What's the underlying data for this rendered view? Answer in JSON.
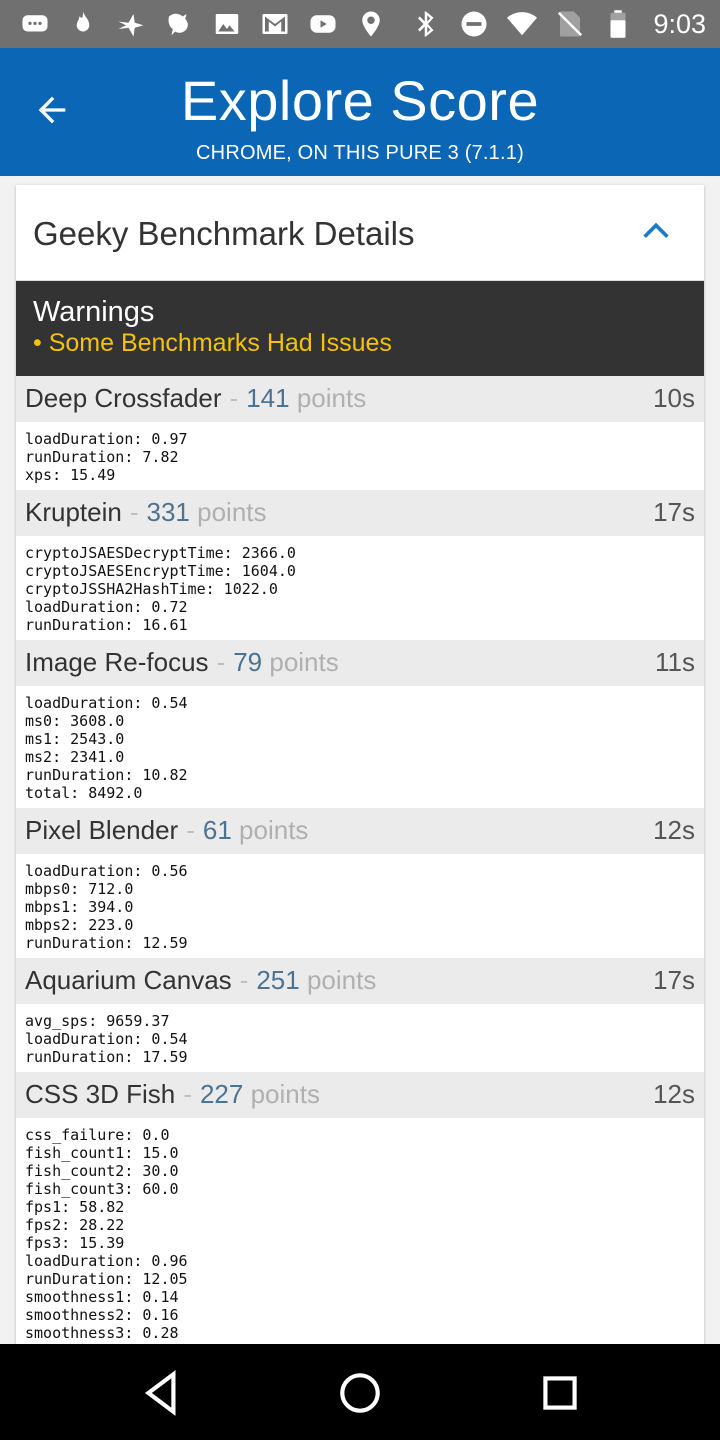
{
  "status_bar": {
    "time": "9:03",
    "left_icons": [
      "messages-icon",
      "fire-icon",
      "bird-icon",
      "dragon-icon",
      "image-icon",
      "gmail-icon",
      "youtube-icon",
      "location-icon"
    ],
    "right_icons": [
      "bluetooth-icon",
      "do-not-disturb-icon",
      "wifi-icon",
      "no-sim-icon",
      "battery-icon"
    ]
  },
  "app_bar": {
    "title": "Explore Score",
    "subtitle": "CHROME, ON THIS PURE 3 (7.1.1)"
  },
  "card": {
    "title": "Geeky Benchmark Details",
    "warnings_title": "Warnings",
    "warning_item": "• Some Benchmarks Had Issues"
  },
  "benchmarks": [
    {
      "name": "Deep Crossfader",
      "points": "141",
      "points_label": "points",
      "time": "10s",
      "metrics": [
        "loadDuration: 0.97",
        "runDuration: 7.82",
        "xps: 15.49"
      ]
    },
    {
      "name": "Kruptein",
      "points": "331",
      "points_label": "points",
      "time": "17s",
      "metrics": [
        "cryptoJSAESDecryptTime: 2366.0",
        "cryptoJSAESEncryptTime: 1604.0",
        "cryptoJSSHA2HashTime: 1022.0",
        "loadDuration: 0.72",
        "runDuration: 16.61"
      ]
    },
    {
      "name": "Image Re-focus",
      "points": "79",
      "points_label": "points",
      "time": "11s",
      "metrics": [
        "loadDuration: 0.54",
        "ms0: 3608.0",
        "ms1: 2543.0",
        "ms2: 2341.0",
        "runDuration: 10.82",
        "total: 8492.0"
      ]
    },
    {
      "name": "Pixel Blender",
      "points": "61",
      "points_label": "points",
      "time": "12s",
      "metrics": [
        "loadDuration: 0.56",
        "mbps0: 712.0",
        "mbps1: 394.0",
        "mbps2: 223.0",
        "runDuration: 12.59"
      ]
    },
    {
      "name": "Aquarium Canvas",
      "points": "251",
      "points_label": "points",
      "time": "17s",
      "metrics": [
        "avg_sps: 9659.37",
        "loadDuration: 0.54",
        "runDuration: 17.59"
      ]
    },
    {
      "name": "CSS 3D Fish",
      "points": "227",
      "points_label": "points",
      "time": "12s",
      "metrics": [
        "css_failure: 0.0",
        "fish_count1: 15.0",
        "fish_count2: 30.0",
        "fish_count3: 60.0",
        "fps1: 58.82",
        "fps2: 28.22",
        "fps3: 15.39",
        "loadDuration: 0.96",
        "runDuration: 12.05",
        "smoothness1: 0.14",
        "smoothness2: 0.16",
        "smoothness3: 0.28"
      ]
    }
  ],
  "nav_bar": {
    "icons": [
      "back-nav-icon",
      "home-nav-icon",
      "recents-nav-icon"
    ]
  },
  "colors": {
    "app_bar": "#0b66b5",
    "warning_bg": "#333333",
    "warning_text": "#f4c20d",
    "points_text": "#4a7394",
    "accent": "#1a7bc4"
  }
}
